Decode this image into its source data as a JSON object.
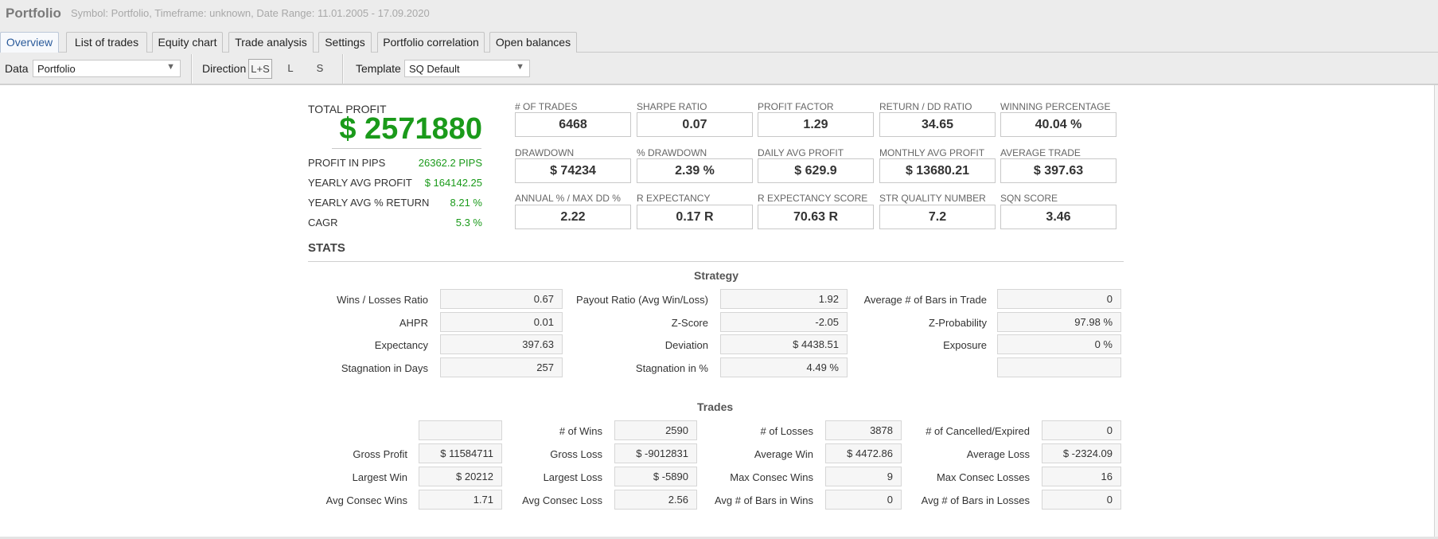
{
  "window": {
    "title": "Portfolio",
    "subtitle": "Symbol: Portfolio, Timeframe: unknown, Date Range: 11.01.2005 - 17.09.2020"
  },
  "tabs": [
    {
      "label": "Overview",
      "active": true
    },
    {
      "label": "List of trades"
    },
    {
      "label": "Equity chart"
    },
    {
      "label": "Trade analysis"
    },
    {
      "label": "Settings"
    },
    {
      "label": "Portfolio correlation"
    },
    {
      "label": "Open balances"
    }
  ],
  "toolbar": {
    "data_label": "Data",
    "data_value": "Portfolio",
    "direction_label": "Direction",
    "direction_options": [
      "L+S",
      "L",
      "S"
    ],
    "direction_selected": "L+S",
    "template_label": "Template",
    "template_value": "SQ Default",
    "dropdown_arrow": "▼"
  },
  "summary": {
    "total_profit_label": "TOTAL PROFIT",
    "total_profit_value": "$ 2571880",
    "rows": [
      {
        "label": "PROFIT IN PIPS",
        "value": "26362.2 PIPS"
      },
      {
        "label": "YEARLY AVG PROFIT",
        "value": "$ 164142.25"
      },
      {
        "label": "YEARLY AVG % RETURN",
        "value": "8.21 %"
      },
      {
        "label": "CAGR",
        "value": "5.3 %"
      }
    ],
    "positive_color": "#1a9a1a"
  },
  "metrics": [
    {
      "label": "# OF TRADES",
      "value": "6468"
    },
    {
      "label": "SHARPE RATIO",
      "value": "0.07"
    },
    {
      "label": "PROFIT FACTOR",
      "value": "1.29"
    },
    {
      "label": "RETURN / DD RATIO",
      "value": "34.65"
    },
    {
      "label": "WINNING PERCENTAGE",
      "value": "40.04 %"
    },
    {
      "label": "DRAWDOWN",
      "value": "$ 74234"
    },
    {
      "label": "% DRAWDOWN",
      "value": "2.39 %"
    },
    {
      "label": "DAILY AVG PROFIT",
      "value": "$ 629.9"
    },
    {
      "label": "MONTHLY AVG PROFIT",
      "value": "$ 13680.21"
    },
    {
      "label": "AVERAGE TRADE",
      "value": "$ 397.63"
    },
    {
      "label": "ANNUAL % / MAX DD %",
      "value": "2.22"
    },
    {
      "label": "R EXPECTANCY",
      "value": "0.17 R"
    },
    {
      "label": "R EXPECTANCY SCORE",
      "value": "70.63 R"
    },
    {
      "label": "STR QUALITY NUMBER",
      "value": "7.2"
    },
    {
      "label": "SQN SCORE",
      "value": "3.46"
    }
  ],
  "stats": {
    "title": "STATS",
    "strategy": {
      "title": "Strategy",
      "rows": [
        [
          {
            "label": "Wins / Losses Ratio",
            "value": "0.67"
          },
          {
            "label": "Payout Ratio (Avg Win/Loss)",
            "value": "1.92"
          },
          {
            "label": "Average # of Bars in Trade",
            "value": "0"
          }
        ],
        [
          {
            "label": "AHPR",
            "value": "0.01"
          },
          {
            "label": "Z-Score",
            "value": "-2.05"
          },
          {
            "label": "Z-Probability",
            "value": "97.98 %"
          }
        ],
        [
          {
            "label": "Expectancy",
            "value": "397.63"
          },
          {
            "label": "Deviation",
            "value": "$ 4438.51"
          },
          {
            "label": "Exposure",
            "value": "0 %"
          }
        ],
        [
          {
            "label": "Stagnation in Days",
            "value": "257"
          },
          {
            "label": "Stagnation in %",
            "value": "4.49 %"
          },
          {
            "label": "",
            "value": ""
          }
        ]
      ]
    },
    "trades": {
      "title": "Trades",
      "rows": [
        [
          {
            "label": "",
            "value": ""
          },
          {
            "label": "# of Wins",
            "value": "2590"
          },
          {
            "label": "# of Losses",
            "value": "3878"
          },
          {
            "label": "# of Cancelled/Expired",
            "value": "0"
          }
        ],
        [
          {
            "label": "Gross Profit",
            "value": "$ 11584711"
          },
          {
            "label": "Gross Loss",
            "value": "$ -9012831"
          },
          {
            "label": "Average Win",
            "value": "$ 4472.86"
          },
          {
            "label": "Average Loss",
            "value": "$ -2324.09"
          }
        ],
        [
          {
            "label": "Largest Win",
            "value": "$ 20212"
          },
          {
            "label": "Largest Loss",
            "value": "$ -5890"
          },
          {
            "label": "Max Consec Wins",
            "value": "9"
          },
          {
            "label": "Max Consec Losses",
            "value": "16"
          }
        ],
        [
          {
            "label": "Avg Consec Wins",
            "value": "1.71"
          },
          {
            "label": "Avg Consec Loss",
            "value": "2.56"
          },
          {
            "label": "Avg # of Bars in Wins",
            "value": "0"
          },
          {
            "label": "Avg # of Bars in Losses",
            "value": "0"
          }
        ]
      ]
    }
  }
}
